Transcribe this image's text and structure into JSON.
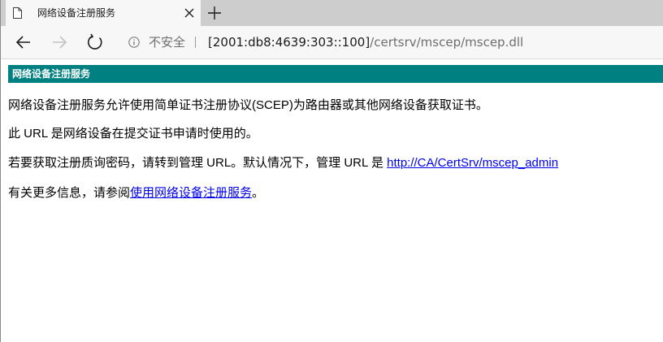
{
  "browser": {
    "tab": {
      "title": "网络设备注册服务"
    },
    "address": {
      "security_label": "不安全",
      "url_host": "[2001:db8:4639:303::100]",
      "url_path": "/certsrv/mscep/mscep.dll"
    },
    "icons": {
      "favicon": "page-icon",
      "close": "close-icon",
      "new_tab": "plus-icon",
      "back": "back-arrow-icon",
      "forward": "forward-arrow-icon",
      "refresh": "refresh-icon",
      "info": "info-icon"
    }
  },
  "page": {
    "header_title": "网络设备注册服务",
    "colors": {
      "header_bg": "#008080",
      "link": "#0000ee"
    },
    "para1": "网络设备注册服务允许使用简单证书注册协议(SCEP)为路由器或其他网络设备获取证书。",
    "para2": "此 URL 是网络设备在提交证书申请时使用的。",
    "para3_prefix": "若要获取注册质询密码，请转到管理 URL。默认情况下，管理 URL 是 ",
    "para3_link": "http://CA/CertSrv/mscep_admin",
    "para4_prefix": "有关更多信息，请参阅",
    "para4_link": "使用网络设备注册服务",
    "para4_suffix": "。"
  }
}
